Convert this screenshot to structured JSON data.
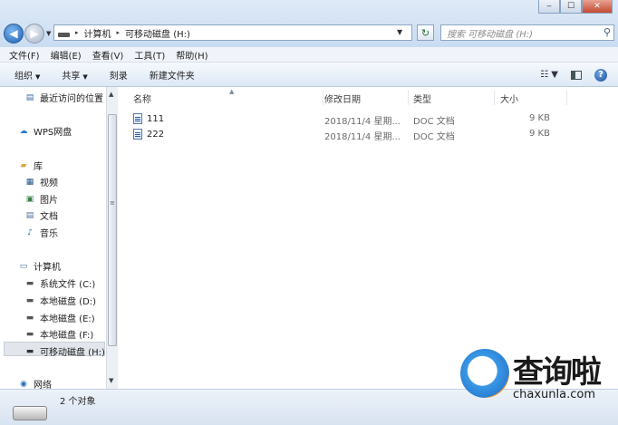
{
  "window": {
    "controls": {
      "minimize": "‒",
      "maximize": "☐",
      "close": "✕"
    }
  },
  "address": {
    "crumbs": [
      "计算机",
      "可移动磁盘 (H:)"
    ],
    "search_placeholder": "搜索 可移动磁盘 (H:)"
  },
  "menu": [
    "文件(F)",
    "编辑(E)",
    "查看(V)",
    "工具(T)",
    "帮助(H)"
  ],
  "toolbar": {
    "organize": "组织",
    "share": "共享",
    "burn": "刻录",
    "new_folder": "新建文件夹"
  },
  "nav": {
    "recent": "最近访问的位置",
    "wps": "WPS网盘",
    "library": "库",
    "videos": "视频",
    "pictures": "图片",
    "documents": "文档",
    "music": "音乐",
    "computer": "计算机",
    "drive_c": "系统文件 (C:)",
    "drive_d": "本地磁盘 (D:)",
    "drive_e": "本地磁盘 (E:)",
    "drive_f": "本地磁盘 (F:)",
    "drive_h": "可移动磁盘 (H:)",
    "network": "网络"
  },
  "columns": {
    "name": "名称",
    "modified": "修改日期",
    "type": "类型",
    "size": "大小"
  },
  "files": [
    {
      "name": "111",
      "modified": "2018/11/4 星期...",
      "type": "DOC 文档",
      "size": "9 KB"
    },
    {
      "name": "222",
      "modified": "2018/11/4 星期...",
      "type": "DOC 文档",
      "size": "9 KB"
    }
  ],
  "status": {
    "count": "2 个对象"
  },
  "watermark": {
    "text": "查询啦",
    "url": "chaxunla.com"
  },
  "icons": {
    "back": "back-arrow-icon",
    "forward": "forward-arrow-icon",
    "refresh": "refresh-icon",
    "search": "magnifier-icon",
    "help": "help-icon"
  }
}
